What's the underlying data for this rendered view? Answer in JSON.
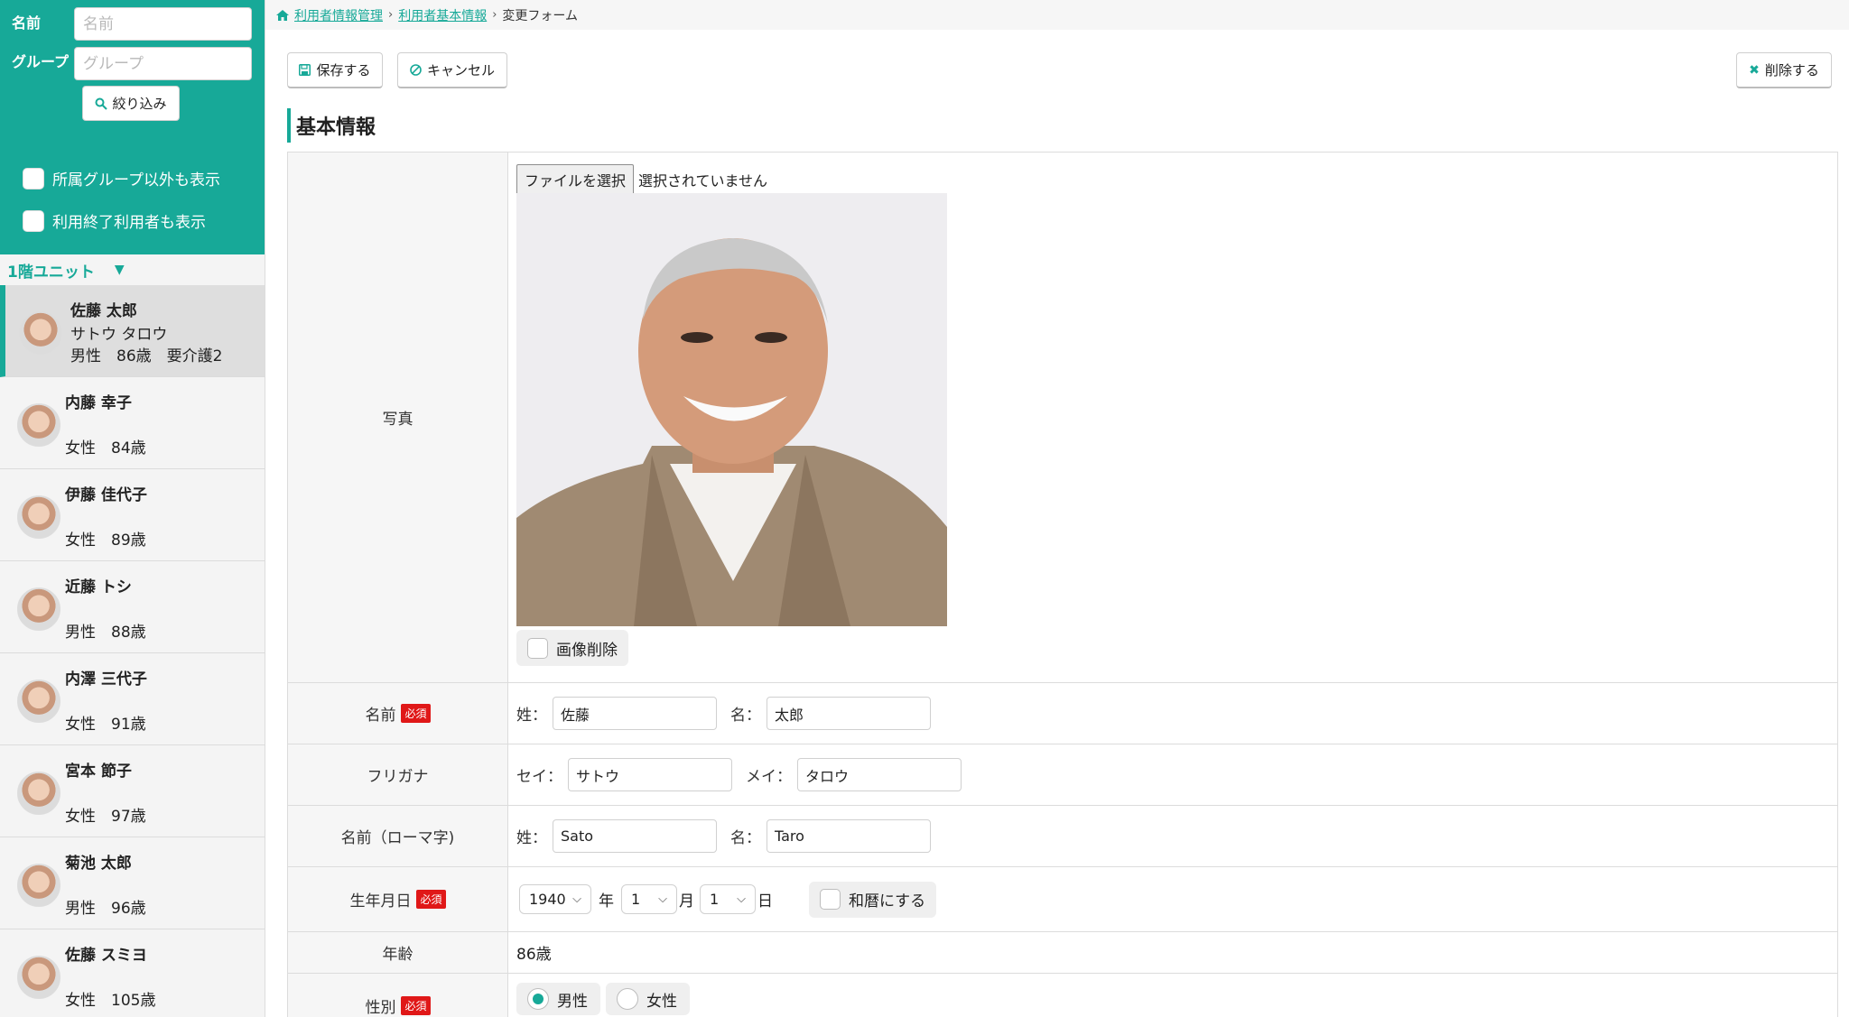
{
  "sidebar": {
    "filter": {
      "name_label": "名前",
      "name_placeholder": "名前",
      "group_label": "グループ",
      "group_placeholder": "グループ",
      "filter_button": "絞り込み",
      "checks": [
        "所属グループ以外も表示",
        "利用終了利用者も表示"
      ]
    },
    "unit": {
      "label": "1階ユニット",
      "arrow": "▼"
    },
    "users": [
      {
        "name": "佐藤 太郎",
        "kana": "サトウ タロウ",
        "info": "男性　86歳　要介護2",
        "active": true
      },
      {
        "name": "内藤 幸子",
        "kana": "",
        "info": "女性　84歳",
        "active": false
      },
      {
        "name": "伊藤 佳代子",
        "kana": "",
        "info": "女性　89歳",
        "active": false
      },
      {
        "name": "近藤 トシ",
        "kana": "",
        "info": "男性　88歳",
        "active": false
      },
      {
        "name": "内澤 三代子",
        "kana": "",
        "info": "女性　91歳",
        "active": false
      },
      {
        "name": "宮本 節子",
        "kana": "",
        "info": "女性　97歳",
        "active": false
      },
      {
        "name": "菊池 太郎",
        "kana": "",
        "info": "男性　96歳",
        "active": false
      },
      {
        "name": "佐藤 スミヨ",
        "kana": "",
        "info": "女性　105歳",
        "active": false
      }
    ]
  },
  "breadcrumb": {
    "items": [
      "利用者情報管理",
      "利用者基本情報"
    ],
    "current": "変更フォーム"
  },
  "toolbar": {
    "save": "保存する",
    "cancel": "キャンセル",
    "delete": "削除する"
  },
  "section_title": "基本情報",
  "form": {
    "photo": {
      "label": "写真",
      "file_button": "ファイルを選択",
      "file_status": "選択されていません",
      "delete_image": "画像削除"
    },
    "name": {
      "label": "名前",
      "required": "必須",
      "last_label": "姓：",
      "last": "佐藤",
      "first_label": "名：",
      "first": "太郎"
    },
    "kana": {
      "label": "フリガナ",
      "last_label": "セイ：",
      "last": "サトウ",
      "first_label": "メイ：",
      "first": "タロウ"
    },
    "roman": {
      "label": "名前（ローマ字)",
      "last_label": "姓：",
      "last": "Sato",
      "first_label": "名：",
      "first": "Taro"
    },
    "birth": {
      "label": "生年月日",
      "required": "必須",
      "year": "1940",
      "year_unit": "年",
      "month": "1",
      "month_unit": "月",
      "day": "1",
      "day_unit": "日",
      "wareki": "和暦にする"
    },
    "age": {
      "label": "年齢",
      "value": "86歳"
    },
    "gender": {
      "label": "性別",
      "required": "必須",
      "male": "男性",
      "female": "女性",
      "selected": "male"
    }
  },
  "colors": {
    "accent": "#17a998",
    "required": "#e01818"
  }
}
